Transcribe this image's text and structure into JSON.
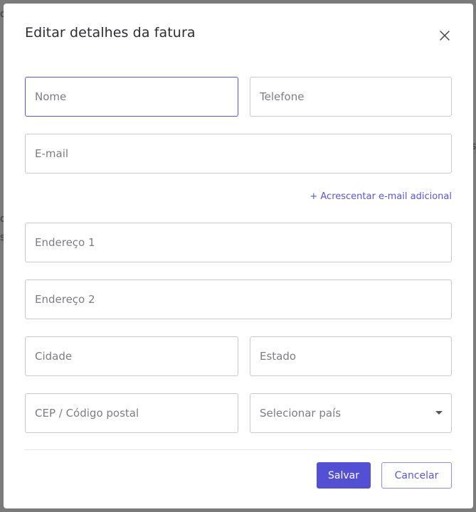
{
  "background": {
    "fragments": [
      "o",
      "o",
      "s",
      "s"
    ]
  },
  "modal": {
    "title": "Editar detalhes da fatura",
    "close_icon": "close-icon"
  },
  "form": {
    "name_placeholder": "Nome",
    "phone_placeholder": "Telefone",
    "email_placeholder": "E-mail",
    "add_email_label": "+ Acrescentar e-mail adicional",
    "address1_placeholder": "Endereço 1",
    "address2_placeholder": "Endereço 2",
    "city_placeholder": "Cidade",
    "state_placeholder": "Estado",
    "postal_placeholder": "CEP / Código postal",
    "country_selected": "Selecionar país"
  },
  "actions": {
    "save_label": "Salvar",
    "cancel_label": "Cancelar"
  },
  "colors": {
    "accent": "#5450d6",
    "overlay": "#7b7b7b",
    "border": "#c9c9cf",
    "focus_border": "#5a56d8"
  }
}
